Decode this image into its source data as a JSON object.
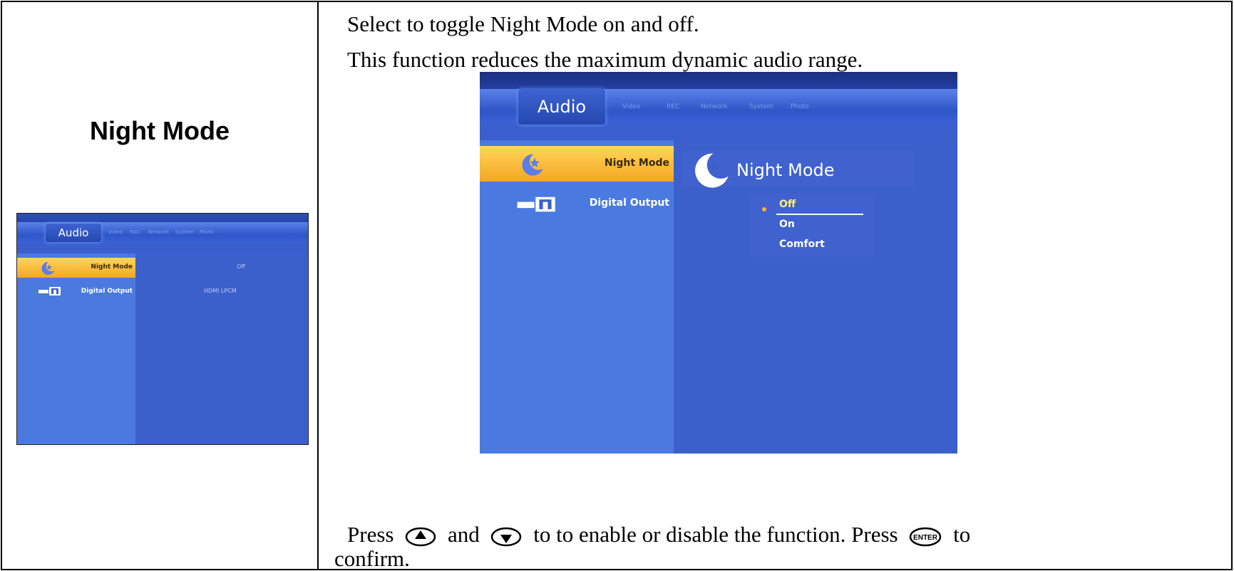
{
  "left": {
    "title": "Night Mode"
  },
  "description": {
    "line1": "Select to toggle Night Mode on and off.",
    "line2": "This function reduces the maximum dynamic audio range."
  },
  "instructions": {
    "press1": "Press",
    "and": "and",
    "mid": "to to enable or disable the function. Press",
    "to": "to",
    "line2": "confirm.",
    "up_icon": "up-arrow-button-icon",
    "down_icon": "down-arrow-button-icon",
    "enter_icon": "enter-button-icon",
    "enter_label": "ENTER"
  },
  "screen_small": {
    "tabs": {
      "active": "Audio",
      "others": [
        "Video",
        "REC",
        "Network",
        "System",
        "Photo"
      ]
    },
    "menu": [
      {
        "label": "Night Mode",
        "icon": "moon-star-icon",
        "value": "Off",
        "selected": true
      },
      {
        "label": "Digital Output",
        "icon": "speaker-output-icon",
        "value": "HDMI LPCM",
        "selected": false
      }
    ]
  },
  "screen_big": {
    "tabs": {
      "active": "Audio",
      "others": [
        "Video",
        "REC",
        "Network",
        "System",
        "Photo"
      ]
    },
    "menu": [
      {
        "label": "Night Mode",
        "icon": "moon-star-icon",
        "selected": true
      },
      {
        "label": "Digital Output",
        "icon": "speaker-output-icon",
        "selected": false
      }
    ],
    "panel": {
      "title": "Night Mode",
      "icon": "moon-star-icon",
      "options": [
        "Off",
        "On",
        "Comfort"
      ],
      "selected_option": "Off"
    }
  },
  "colors": {
    "screen_bg": "#3a5fcd",
    "sidebar": "#4a7ae0",
    "highlight": "#f5a623"
  }
}
